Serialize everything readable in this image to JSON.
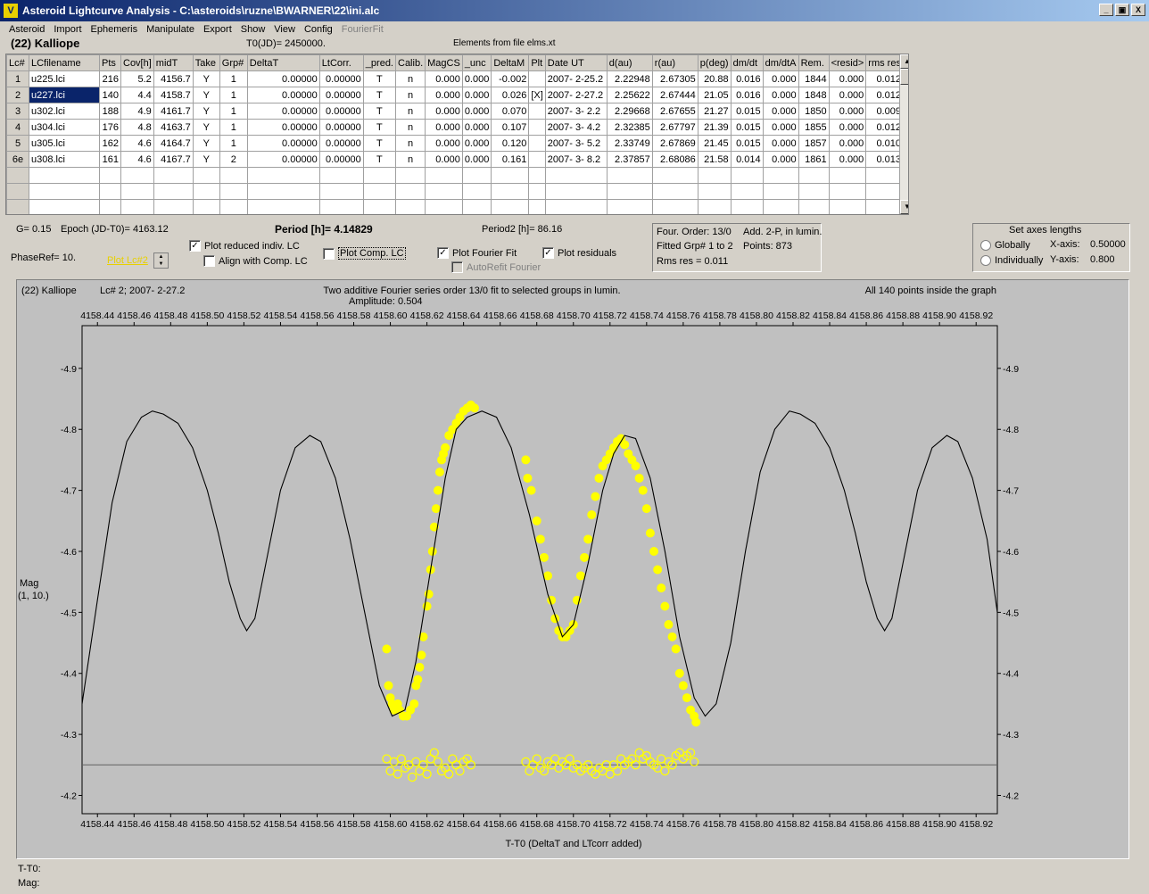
{
  "window": {
    "title": "Asteroid Lightcurve Analysis - C:\\asteroids\\ruzne\\BWARNER\\22\\ini.alc",
    "app_icon": "lightcurve-app-icon",
    "buttons": [
      "_",
      "▣",
      "X"
    ]
  },
  "menu": {
    "items": [
      "Asteroid",
      "Import",
      "Ephemeris",
      "Manipulate",
      "Export",
      "Show",
      "View",
      "Config"
    ],
    "disabled_item": "FourierFit"
  },
  "info": {
    "asteroid": "(22) Kalliope",
    "t0": "T0(JD)= 2450000.",
    "elements": "Elements from file elms.xt"
  },
  "table": {
    "columns": [
      "Lc#",
      "LCfilename",
      "Pts",
      "Cov[h]",
      "midT",
      "Take",
      "Grp#",
      "DeltaT",
      "LtCorr.",
      "_pred.",
      "Calib.",
      "MagCS",
      "_unc",
      "DeltaM",
      "Plt",
      "Date UT",
      "d(au)",
      "r(au)",
      "p(deg)",
      "dm/dt",
      "dm/dtA",
      "Rem.",
      "<resid>",
      "rms res"
    ],
    "rows": [
      [
        "1",
        "u225.lci",
        "216",
        "5.2",
        "4156.7",
        "Y",
        "1",
        "0.00000",
        "0.00000",
        "T",
        "n",
        "0.000",
        "0.000",
        "-0.002",
        "",
        "2007- 2-25.2",
        "2.22948",
        "2.67305",
        "20.88",
        "0.016",
        "0.000",
        "1844",
        "0.000",
        "0.012"
      ],
      [
        "2",
        "u227.lci",
        "140",
        "4.4",
        "4158.7",
        "Y",
        "1",
        "0.00000",
        "0.00000",
        "T",
        "n",
        "0.000",
        "0.000",
        "0.026",
        "[X]",
        "2007- 2-27.2",
        "2.25622",
        "2.67444",
        "21.05",
        "0.016",
        "0.000",
        "1848",
        "0.000",
        "0.012"
      ],
      [
        "3",
        "u302.lci",
        "188",
        "4.9",
        "4161.7",
        "Y",
        "1",
        "0.00000",
        "0.00000",
        "T",
        "n",
        "0.000",
        "0.000",
        "0.070",
        "",
        "2007- 3- 2.2",
        "2.29668",
        "2.67655",
        "21.27",
        "0.015",
        "0.000",
        "1850",
        "0.000",
        "0.009"
      ],
      [
        "4",
        "u304.lci",
        "176",
        "4.8",
        "4163.7",
        "Y",
        "1",
        "0.00000",
        "0.00000",
        "T",
        "n",
        "0.000",
        "0.000",
        "0.107",
        "",
        "2007- 3- 4.2",
        "2.32385",
        "2.67797",
        "21.39",
        "0.015",
        "0.000",
        "1855",
        "0.000",
        "0.012"
      ],
      [
        "5",
        "u305.lci",
        "162",
        "4.6",
        "4164.7",
        "Y",
        "1",
        "0.00000",
        "0.00000",
        "T",
        "n",
        "0.000",
        "0.000",
        "0.120",
        "",
        "2007- 3- 5.2",
        "2.33749",
        "2.67869",
        "21.45",
        "0.015",
        "0.000",
        "1857",
        "0.000",
        "0.010"
      ],
      [
        "6e",
        "u308.lci",
        "161",
        "4.6",
        "4167.7",
        "Y",
        "2",
        "0.00000",
        "0.00000",
        "T",
        "n",
        "0.000",
        "0.000",
        "0.161",
        "",
        "2007- 3- 8.2",
        "2.37857",
        "2.68086",
        "21.58",
        "0.014",
        "0.000",
        "1861",
        "0.000",
        "0.013"
      ]
    ],
    "selected_row": 1,
    "scroll_up": "▲",
    "scroll_down": "▼"
  },
  "controls": {
    "g": "G= 0.15",
    "epoch": "Epoch (JD-T0)= 4163.12",
    "period": "Period [h]= 4.14829",
    "period2": "Period2 [h]= 86.16",
    "phaseref": "PhaseRef= 10.",
    "plot_lc_link": "Plot Lc#2",
    "plot_reduced": {
      "label": "Plot reduced indiv. LC",
      "checked": true
    },
    "align_comp": {
      "label": "Align with Comp. LC",
      "checked": false
    },
    "plot_comp": {
      "label": "Plot Comp. LC",
      "checked": false
    },
    "plot_fourier": {
      "label": "Plot Fourier Fit",
      "checked": true
    },
    "plot_residuals": {
      "label": "Plot residuals",
      "checked": true
    },
    "autorefit": {
      "label": "AutoRefit Fourier",
      "checked": false
    },
    "check_mark": "✓"
  },
  "fourier_box": {
    "order": "Four. Order: 13/0",
    "mode": "Add. 2-P, in lumin.",
    "fitted": "Fitted Grp# 1 to 2",
    "points": "Points: 873",
    "rms": "Rms res     = 0.011"
  },
  "axes_box": {
    "title": "Set axes lengths",
    "globally": "Globally",
    "individually": "Individually",
    "x_label": "X-axis:",
    "x_value": "0.50000",
    "y_label": "Y-axis:",
    "y_value": "0.800"
  },
  "plot": {
    "header_left": "(22) Kalliope",
    "header_lc": "Lc# 2; 2007- 2-27.2",
    "header_title": "Two additive Fourier series order 13/0 fit to selected groups in lumin.",
    "header_amp": "Amplitude: 0.504",
    "header_right": "All 140 points inside the graph",
    "ylabel_line1": "Mag",
    "ylabel_line2": "(1, 10.)",
    "xlabel": "T-T0 (DeltaT and LTcorr added)"
  },
  "chart_data": {
    "type": "scatter",
    "x_ticks": [
      "4158.44",
      "4158.46",
      "4158.48",
      "4158.50",
      "4158.52",
      "4158.54",
      "4158.56",
      "4158.58",
      "4158.60",
      "4158.62",
      "4158.64",
      "4158.66",
      "4158.68",
      "4158.70",
      "4158.72",
      "4158.74",
      "4158.76",
      "4158.78",
      "4158.80",
      "4158.82",
      "4158.84",
      "4158.86",
      "4158.88",
      "4158.90",
      "4158.92"
    ],
    "y_ticks": [
      "-4.9",
      "-4.8",
      "-4.7",
      "-4.6",
      "-4.5",
      "-4.4",
      "-4.3",
      "-4.2"
    ],
    "xlim": [
      4158.4316,
      4158.9316
    ],
    "ylim": [
      -4.97,
      -4.17
    ],
    "grid": false,
    "residual_baseline": -4.25,
    "fourier_fit": [
      [
        4158.4316,
        -4.35
      ],
      [
        4158.44,
        -4.52
      ],
      [
        4158.448,
        -4.68
      ],
      [
        4158.456,
        -4.78
      ],
      [
        4158.464,
        -4.82
      ],
      [
        4158.47,
        -4.83
      ],
      [
        4158.476,
        -4.825
      ],
      [
        4158.484,
        -4.81
      ],
      [
        4158.492,
        -4.77
      ],
      [
        4158.5,
        -4.7
      ],
      [
        4158.506,
        -4.63
      ],
      [
        4158.512,
        -4.55
      ],
      [
        4158.518,
        -4.49
      ],
      [
        4158.5215,
        -4.47
      ],
      [
        4158.526,
        -4.49
      ],
      [
        4158.532,
        -4.58
      ],
      [
        4158.54,
        -4.7
      ],
      [
        4158.548,
        -4.77
      ],
      [
        4158.556,
        -4.79
      ],
      [
        4158.562,
        -4.78
      ],
      [
        4158.57,
        -4.72
      ],
      [
        4158.578,
        -4.62
      ],
      [
        4158.586,
        -4.5
      ],
      [
        4158.594,
        -4.38
      ],
      [
        4158.601,
        -4.33
      ],
      [
        4158.608,
        -4.34
      ],
      [
        4158.614,
        -4.42
      ],
      [
        4158.622,
        -4.57
      ],
      [
        4158.63,
        -4.72
      ],
      [
        4158.636,
        -4.8
      ],
      [
        4158.642,
        -4.82
      ],
      [
        4158.65,
        -4.83
      ],
      [
        4158.658,
        -4.82
      ],
      [
        4158.666,
        -4.77
      ],
      [
        4158.676,
        -4.66
      ],
      [
        4158.686,
        -4.53
      ],
      [
        4158.694,
        -4.46
      ],
      [
        4158.7,
        -4.48
      ],
      [
        4158.708,
        -4.58
      ],
      [
        4158.716,
        -4.7
      ],
      [
        4158.722,
        -4.76
      ],
      [
        4158.728,
        -4.79
      ],
      [
        4158.734,
        -4.785
      ],
      [
        4158.742,
        -4.72
      ],
      [
        4158.75,
        -4.6
      ],
      [
        4158.758,
        -4.46
      ],
      [
        4158.766,
        -4.36
      ],
      [
        4158.772,
        -4.33
      ],
      [
        4158.778,
        -4.35
      ],
      [
        4158.786,
        -4.45
      ],
      [
        4158.794,
        -4.6
      ],
      [
        4158.802,
        -4.73
      ],
      [
        4158.81,
        -4.8
      ],
      [
        4158.818,
        -4.83
      ],
      [
        4158.824,
        -4.825
      ],
      [
        4158.832,
        -4.81
      ],
      [
        4158.84,
        -4.77
      ],
      [
        4158.848,
        -4.7
      ],
      [
        4158.854,
        -4.63
      ],
      [
        4158.86,
        -4.55
      ],
      [
        4158.866,
        -4.49
      ],
      [
        4158.87,
        -4.47
      ],
      [
        4158.874,
        -4.49
      ],
      [
        4158.88,
        -4.58
      ],
      [
        4158.888,
        -4.7
      ],
      [
        4158.896,
        -4.77
      ],
      [
        4158.904,
        -4.79
      ],
      [
        4158.91,
        -4.78
      ],
      [
        4158.918,
        -4.72
      ],
      [
        4158.926,
        -4.62
      ],
      [
        4158.9316,
        -4.5
      ]
    ],
    "observations": [
      [
        4158.598,
        -4.44
      ],
      [
        4158.599,
        -4.38
      ],
      [
        4158.6,
        -4.36
      ],
      [
        4158.601,
        -4.35
      ],
      [
        4158.602,
        -4.34
      ],
      [
        4158.603,
        -4.345
      ],
      [
        4158.604,
        -4.35
      ],
      [
        4158.605,
        -4.34
      ],
      [
        4158.607,
        -4.33
      ],
      [
        4158.609,
        -4.33
      ],
      [
        4158.611,
        -4.34
      ],
      [
        4158.613,
        -4.35
      ],
      [
        4158.614,
        -4.38
      ],
      [
        4158.615,
        -4.39
      ],
      [
        4158.616,
        -4.41
      ],
      [
        4158.617,
        -4.43
      ],
      [
        4158.618,
        -4.46
      ],
      [
        4158.62,
        -4.51
      ],
      [
        4158.621,
        -4.53
      ],
      [
        4158.622,
        -4.57
      ],
      [
        4158.623,
        -4.6
      ],
      [
        4158.624,
        -4.64
      ],
      [
        4158.625,
        -4.67
      ],
      [
        4158.626,
        -4.7
      ],
      [
        4158.627,
        -4.73
      ],
      [
        4158.628,
        -4.75
      ],
      [
        4158.629,
        -4.76
      ],
      [
        4158.63,
        -4.77
      ],
      [
        4158.632,
        -4.79
      ],
      [
        4158.634,
        -4.8
      ],
      [
        4158.636,
        -4.81
      ],
      [
        4158.638,
        -4.82
      ],
      [
        4158.64,
        -4.83
      ],
      [
        4158.642,
        -4.835
      ],
      [
        4158.644,
        -4.84
      ],
      [
        4158.646,
        -4.835
      ],
      [
        4158.674,
        -4.75
      ],
      [
        4158.675,
        -4.72
      ],
      [
        4158.677,
        -4.7
      ],
      [
        4158.68,
        -4.65
      ],
      [
        4158.682,
        -4.62
      ],
      [
        4158.684,
        -4.59
      ],
      [
        4158.686,
        -4.56
      ],
      [
        4158.688,
        -4.52
      ],
      [
        4158.69,
        -4.49
      ],
      [
        4158.692,
        -4.47
      ],
      [
        4158.694,
        -4.46
      ],
      [
        4158.696,
        -4.46
      ],
      [
        4158.698,
        -4.47
      ],
      [
        4158.7,
        -4.48
      ],
      [
        4158.702,
        -4.52
      ],
      [
        4158.704,
        -4.56
      ],
      [
        4158.706,
        -4.59
      ],
      [
        4158.708,
        -4.62
      ],
      [
        4158.71,
        -4.66
      ],
      [
        4158.712,
        -4.69
      ],
      [
        4158.714,
        -4.72
      ],
      [
        4158.716,
        -4.74
      ],
      [
        4158.718,
        -4.75
      ],
      [
        4158.72,
        -4.76
      ],
      [
        4158.722,
        -4.77
      ],
      [
        4158.724,
        -4.78
      ],
      [
        4158.726,
        -4.785
      ],
      [
        4158.728,
        -4.775
      ],
      [
        4158.73,
        -4.76
      ],
      [
        4158.732,
        -4.75
      ],
      [
        4158.734,
        -4.74
      ],
      [
        4158.736,
        -4.72
      ],
      [
        4158.738,
        -4.7
      ],
      [
        4158.74,
        -4.67
      ],
      [
        4158.742,
        -4.63
      ],
      [
        4158.744,
        -4.6
      ],
      [
        4158.746,
        -4.57
      ],
      [
        4158.748,
        -4.54
      ],
      [
        4158.75,
        -4.51
      ],
      [
        4158.752,
        -4.48
      ],
      [
        4158.754,
        -4.46
      ],
      [
        4158.756,
        -4.44
      ],
      [
        4158.758,
        -4.4
      ],
      [
        4158.76,
        -4.38
      ],
      [
        4158.762,
        -4.36
      ],
      [
        4158.764,
        -4.34
      ],
      [
        4158.766,
        -4.33
      ],
      [
        4158.767,
        -4.32
      ]
    ],
    "residuals": [
      [
        4158.598,
        -4.26
      ],
      [
        4158.6,
        -4.24
      ],
      [
        4158.602,
        -4.255
      ],
      [
        4158.604,
        -4.235
      ],
      [
        4158.606,
        -4.26
      ],
      [
        4158.608,
        -4.245
      ],
      [
        4158.61,
        -4.25
      ],
      [
        4158.612,
        -4.23
      ],
      [
        4158.614,
        -4.255
      ],
      [
        4158.616,
        -4.24
      ],
      [
        4158.618,
        -4.25
      ],
      [
        4158.62,
        -4.235
      ],
      [
        4158.622,
        -4.26
      ],
      [
        4158.624,
        -4.27
      ],
      [
        4158.626,
        -4.255
      ],
      [
        4158.628,
        -4.24
      ],
      [
        4158.63,
        -4.245
      ],
      [
        4158.632,
        -4.235
      ],
      [
        4158.634,
        -4.26
      ],
      [
        4158.636,
        -4.25
      ],
      [
        4158.638,
        -4.24
      ],
      [
        4158.64,
        -4.255
      ],
      [
        4158.642,
        -4.26
      ],
      [
        4158.644,
        -4.25
      ],
      [
        4158.674,
        -4.255
      ],
      [
        4158.676,
        -4.24
      ],
      [
        4158.678,
        -4.25
      ],
      [
        4158.68,
        -4.26
      ],
      [
        4158.682,
        -4.245
      ],
      [
        4158.684,
        -4.24
      ],
      [
        4158.686,
        -4.255
      ],
      [
        4158.688,
        -4.25
      ],
      [
        4158.69,
        -4.26
      ],
      [
        4158.692,
        -4.245
      ],
      [
        4158.694,
        -4.255
      ],
      [
        4158.696,
        -4.25
      ],
      [
        4158.698,
        -4.26
      ],
      [
        4158.7,
        -4.245
      ],
      [
        4158.702,
        -4.25
      ],
      [
        4158.704,
        -4.24
      ],
      [
        4158.706,
        -4.245
      ],
      [
        4158.708,
        -4.25
      ],
      [
        4158.71,
        -4.24
      ],
      [
        4158.712,
        -4.235
      ],
      [
        4158.714,
        -4.245
      ],
      [
        4158.716,
        -4.24
      ],
      [
        4158.718,
        -4.25
      ],
      [
        4158.72,
        -4.235
      ],
      [
        4158.722,
        -4.25
      ],
      [
        4158.724,
        -4.24
      ],
      [
        4158.726,
        -4.26
      ],
      [
        4158.728,
        -4.25
      ],
      [
        4158.73,
        -4.255
      ],
      [
        4158.732,
        -4.26
      ],
      [
        4158.734,
        -4.25
      ],
      [
        4158.736,
        -4.27
      ],
      [
        4158.738,
        -4.26
      ],
      [
        4158.74,
        -4.265
      ],
      [
        4158.742,
        -4.255
      ],
      [
        4158.744,
        -4.25
      ],
      [
        4158.746,
        -4.245
      ],
      [
        4158.748,
        -4.26
      ],
      [
        4158.75,
        -4.24
      ],
      [
        4158.752,
        -4.255
      ],
      [
        4158.754,
        -4.25
      ],
      [
        4158.756,
        -4.265
      ],
      [
        4158.758,
        -4.27
      ],
      [
        4158.76,
        -4.26
      ],
      [
        4158.762,
        -4.265
      ],
      [
        4158.764,
        -4.27
      ],
      [
        4158.766,
        -4.255
      ]
    ],
    "observation_color": "#ffff00",
    "fit_color": "#000000"
  },
  "status": {
    "t_label": "T-T0:",
    "mag_label": "Mag:"
  }
}
